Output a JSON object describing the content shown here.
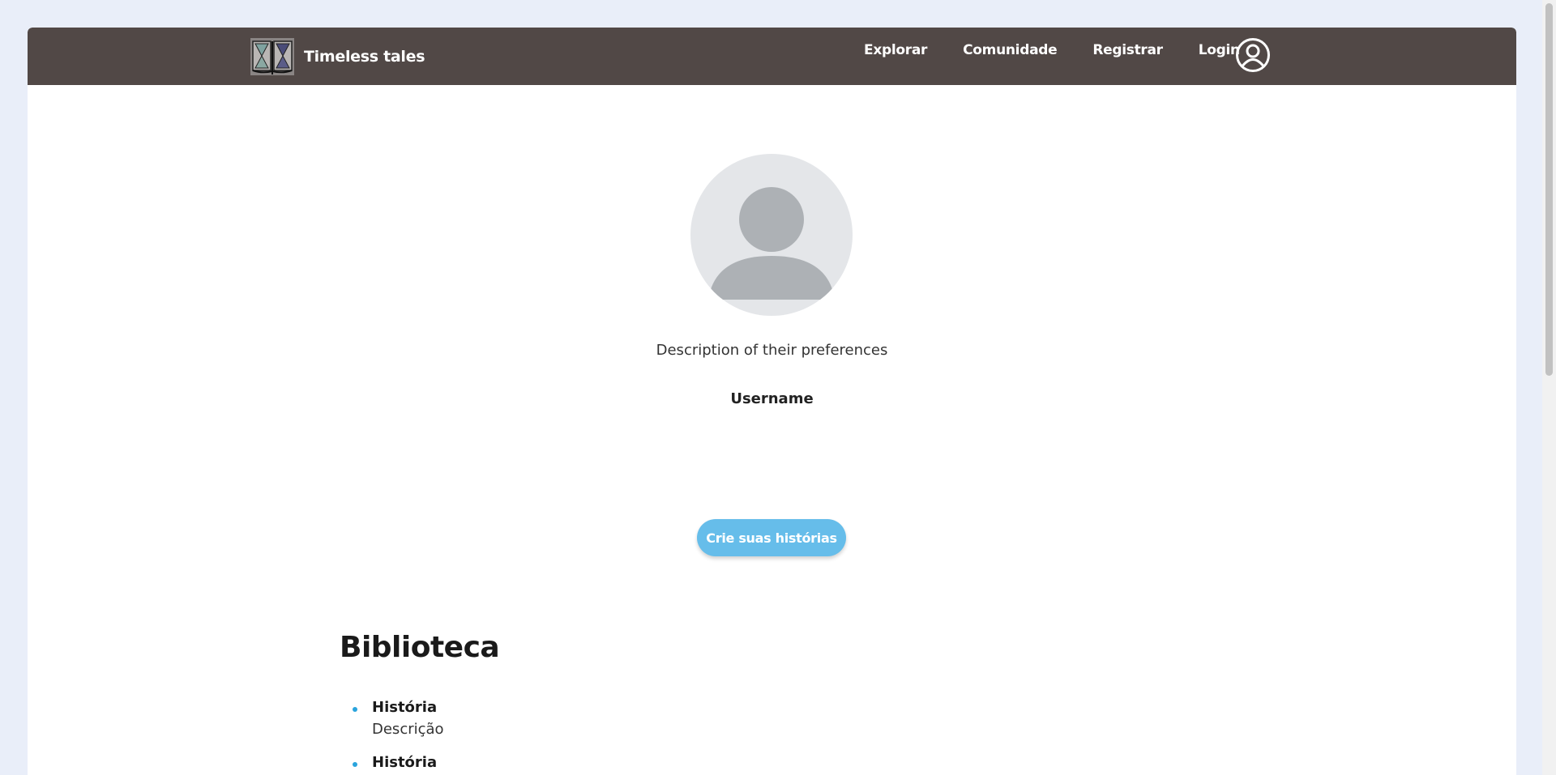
{
  "brand": {
    "name": "Timeless tales",
    "logo_icon": "hourglass-book-logo"
  },
  "nav": {
    "items": [
      {
        "label": "Explorar"
      },
      {
        "label": "Comunidade"
      },
      {
        "label": "Registrar"
      },
      {
        "label": "Login"
      }
    ],
    "user_icon": "user-circle-icon"
  },
  "profile": {
    "avatar_icon": "default-avatar-icon",
    "description": "Description of their preferences",
    "username": "Username",
    "create_button_label": "Crie suas histórias"
  },
  "library": {
    "title": "Biblioteca",
    "stories": [
      {
        "title": "História",
        "description": "Descrição"
      },
      {
        "title": "História",
        "description": ""
      }
    ]
  },
  "colors": {
    "navbar": "#514846",
    "accent_button": "#66bdea",
    "bullet": "#2aa4dd",
    "page_background": "#e9eef9"
  }
}
